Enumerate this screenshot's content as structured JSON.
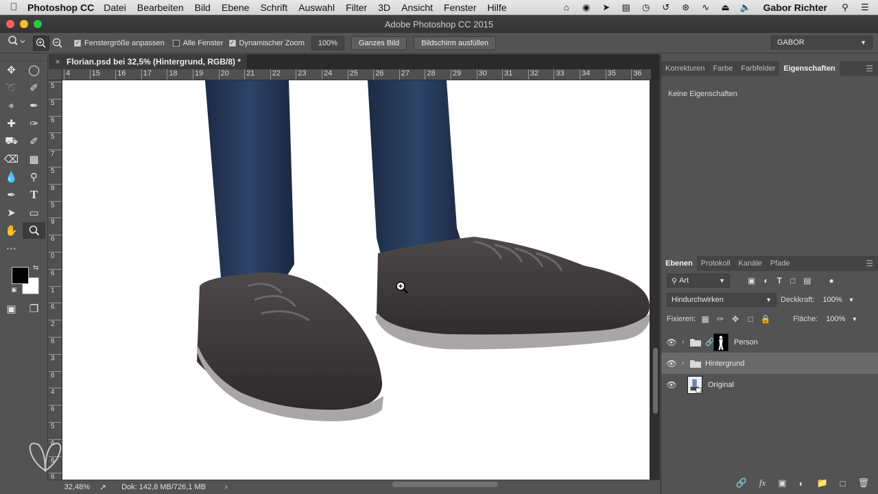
{
  "menubar": {
    "app_name": "Photoshop CC",
    "items": [
      "Datei",
      "Bearbeiten",
      "Bild",
      "Ebene",
      "Schrift",
      "Auswahl",
      "Filter",
      "3D",
      "Ansicht",
      "Fenster",
      "Hilfe"
    ],
    "user": "Gabor Richter"
  },
  "titlebar": {
    "title": "Adobe Photoshop CC 2015"
  },
  "options": {
    "fit_window_label": "Fenstergröße anpassen",
    "fit_window_checked": true,
    "all_windows_label": "Alle Fenster",
    "all_windows_checked": false,
    "dynamic_zoom_label": "Dynamischer Zoom",
    "dynamic_zoom_checked": true,
    "zoom_value": "100%",
    "fit_screen_button": "Ganzes Bild",
    "fill_screen_button": "Bildschirm ausfüllen",
    "workspace": "GABOR"
  },
  "document": {
    "tab_title": "Florian.psd bei 32,5% (Hintergrund, RGB/8) *",
    "hruler_labels": [
      "4",
      "15",
      "16",
      "17",
      "18",
      "19",
      "20",
      "21",
      "22",
      "23",
      "24",
      "25",
      "26",
      "27",
      "28",
      "29",
      "30",
      "31",
      "32",
      "33",
      "34",
      "35",
      "36"
    ],
    "vruler_labels": [
      "5",
      "5",
      "6",
      "5",
      "7",
      "5",
      "8",
      "5",
      "9",
      "6",
      "0",
      "6",
      "1",
      "6",
      "2",
      "6",
      "3",
      "6",
      "4",
      "6",
      "5",
      "6",
      "6",
      "6",
      "7"
    ]
  },
  "statusbar": {
    "zoom": "32,48%",
    "doc_info": "Dok: 142,8 MB/726,1 MB"
  },
  "properties": {
    "tabs": [
      "Korrekturen",
      "Farbe",
      "Farbfelder",
      "Eigenschaften"
    ],
    "active_tab": "Eigenschaften",
    "empty_text": "Keine Eigenschaften"
  },
  "layers": {
    "tabs": [
      "Ebenen",
      "Protokoll",
      "Kanäle",
      "Pfade"
    ],
    "active_tab": "Ebenen",
    "filter_kind": "Art",
    "blend_mode": "Hindurchwirken",
    "opacity_label": "Deckkraft:",
    "opacity_value": "100%",
    "lock_label": "Fixieren:",
    "fill_label": "Fläche:",
    "fill_value": "100%",
    "items": [
      {
        "name": "Person",
        "type": "group-with-mask",
        "visible": true,
        "selected": false
      },
      {
        "name": "Hintergrund",
        "type": "group",
        "visible": true,
        "selected": true
      },
      {
        "name": "Original",
        "type": "smart-object",
        "visible": true,
        "selected": false
      }
    ]
  },
  "colors": {
    "foreground": "#000000",
    "background": "#ffffff",
    "accent_selection": "#6a6a6a"
  }
}
